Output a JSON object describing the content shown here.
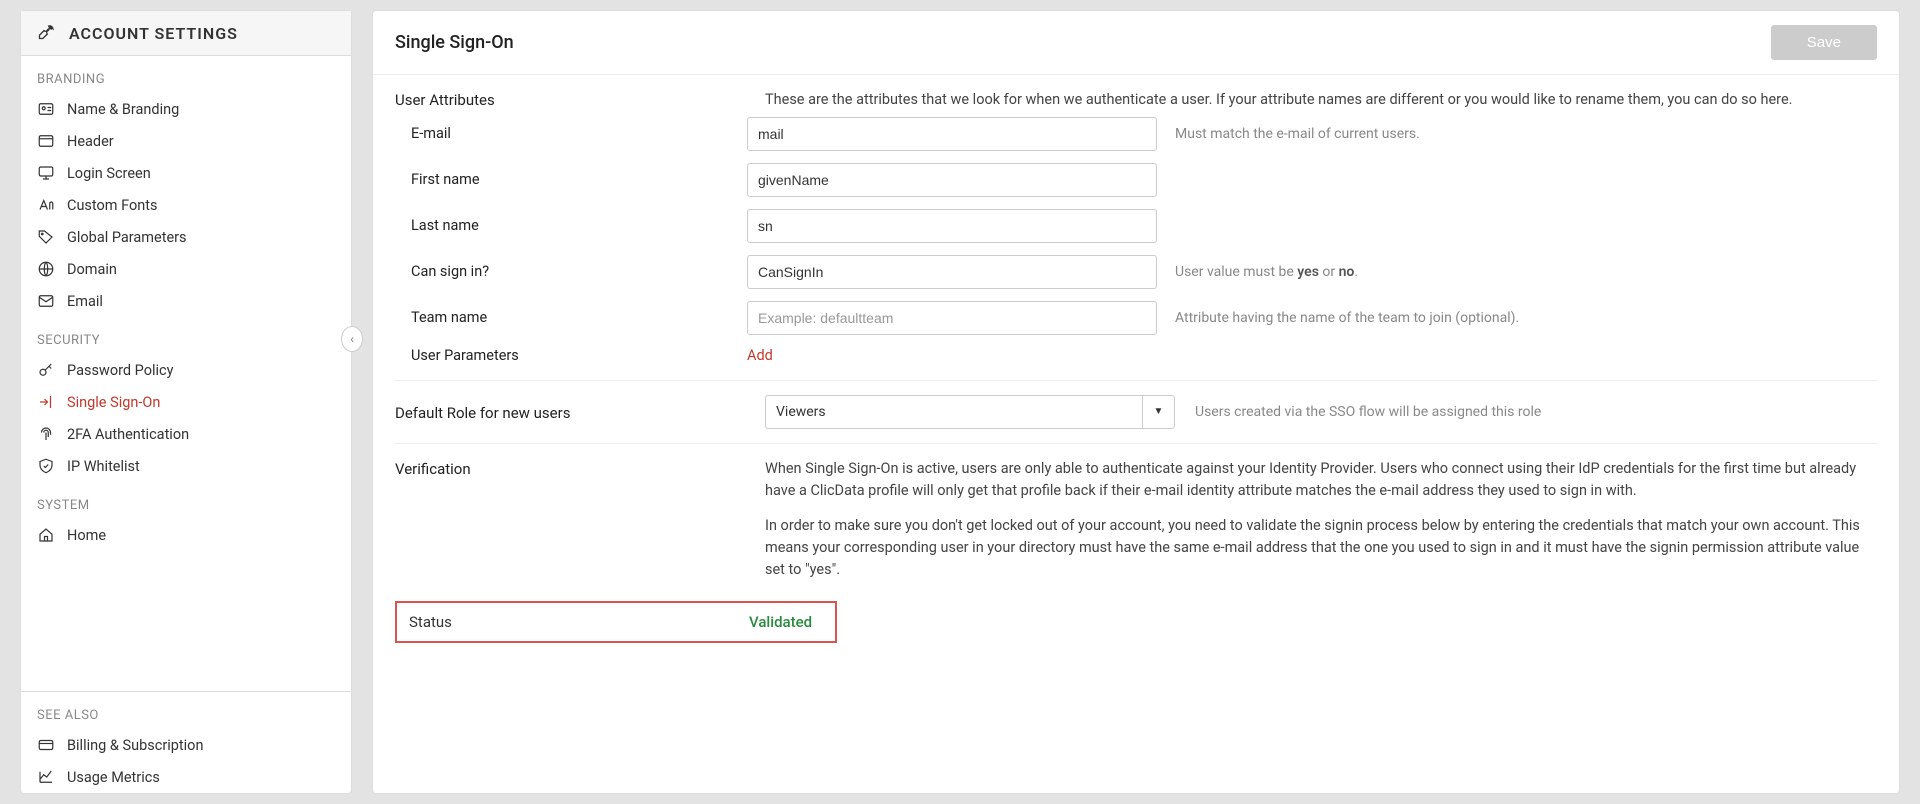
{
  "sidebar": {
    "title": "ACCOUNT SETTINGS",
    "sections": {
      "branding": "BRANDING",
      "security": "SECURITY",
      "system": "SYSTEM",
      "seealso": "SEE ALSO"
    },
    "items": {
      "name_branding": "Name & Branding",
      "header": "Header",
      "login_screen": "Login Screen",
      "custom_fonts": "Custom Fonts",
      "global_parameters": "Global Parameters",
      "domain": "Domain",
      "email": "Email",
      "password_policy": "Password Policy",
      "sso": "Single Sign-On",
      "twofa": "2FA Authentication",
      "ip_whitelist": "IP Whitelist",
      "home": "Home",
      "billing": "Billing & Subscription",
      "usage_metrics": "Usage Metrics"
    }
  },
  "main": {
    "title": "Single Sign-On",
    "save_label": "Save",
    "user_attributes": {
      "label": "User Attributes",
      "description": "These are the attributes that we look for when we authenticate a user. If your attribute names are different or you would like to rename them, you can do so here.",
      "email_label": "E-mail",
      "email_value": "mail",
      "email_hint": "Must match the e-mail of current users.",
      "firstname_label": "First name",
      "firstname_value": "givenName",
      "lastname_label": "Last name",
      "lastname_value": "sn",
      "cansignin_label": "Can sign in?",
      "cansignin_value": "CanSignIn",
      "cansignin_hint_prefix": "User value must be ",
      "cansignin_hint_yes": "yes",
      "cansignin_hint_or": " or ",
      "cansignin_hint_no": "no",
      "cansignin_hint_suffix": ".",
      "teamname_label": "Team name",
      "teamname_placeholder": "Example: defaultteam",
      "teamname_hint": "Attribute having the name of the team to join (optional).",
      "userparams_label": "User Parameters",
      "userparams_add": "Add"
    },
    "default_role": {
      "label": "Default Role for new users",
      "value": "Viewers",
      "hint": "Users created via the SSO flow will be assigned this role"
    },
    "verification": {
      "label": "Verification",
      "p1": "When Single Sign-On is active, users are only able to authenticate against your Identity Provider. Users who connect using their IdP credentials for the first time but already have a ClicData profile will only get that profile back if their e-mail identity attribute matches the e-mail address they used to sign in with.",
      "p2": "In order to make sure you don't get locked out of your account, you need to validate the signin process below by entering the credentials that match your own account. This means your corresponding user in your directory must have the same e-mail address that the one you used to sign in and it must have the signin permission attribute value set to \"yes\"."
    },
    "status": {
      "label": "Status",
      "value": "Validated"
    }
  }
}
